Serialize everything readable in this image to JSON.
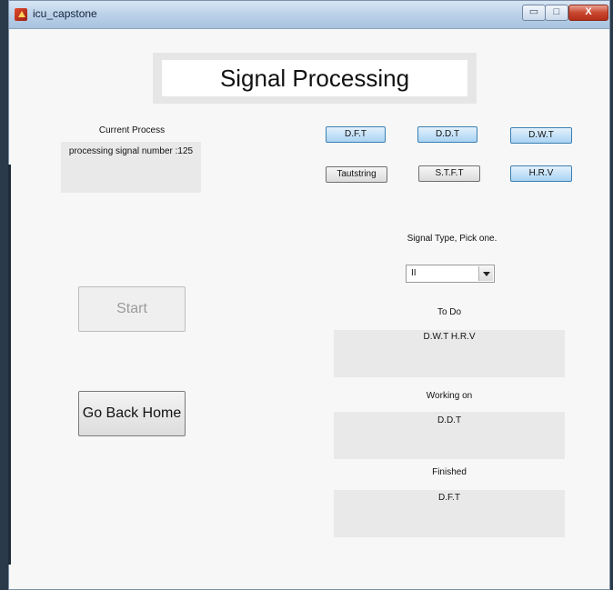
{
  "window": {
    "title": "icu_capstone",
    "minimize": "▭",
    "maximize": "□",
    "close": "X"
  },
  "heading": "Signal Processing",
  "current_process": {
    "label": "Current Process",
    "value": "processing signal number :125"
  },
  "methods": {
    "dft": "D.F.T",
    "ddt": "D.D.T",
    "dwt": "D.W.T",
    "tautstring": "Tautstring",
    "stft": "S.T.F.T",
    "hrv": "H.R.V"
  },
  "signal_type": {
    "label": "Signal Type, Pick one.",
    "selected": "II"
  },
  "buttons": {
    "start": "Start",
    "go_back_home": "Go Back Home"
  },
  "todo": {
    "label": "To Do",
    "value": "D.W.T  H.R.V"
  },
  "working_on": {
    "label": "Working on",
    "value": "D.D.T"
  },
  "finished": {
    "label": "Finished",
    "value": "D.F.T"
  },
  "colors": {
    "highlight_button": "#a9d3f3",
    "panel": "#e9e9e9"
  }
}
